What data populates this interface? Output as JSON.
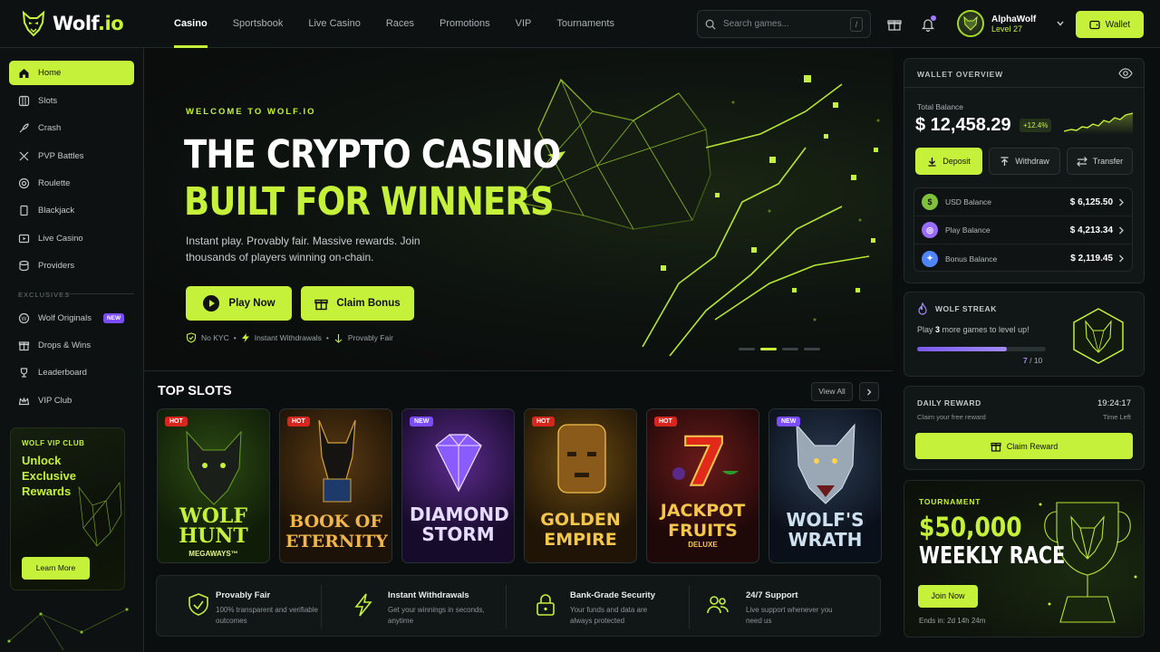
{
  "header": {
    "logo_text": "Wolf",
    "logo_tld": ".io",
    "nav": [
      "Casino",
      "Sportsbook",
      "Live Casino",
      "Races",
      "Promotions",
      "VIP",
      "Tournaments"
    ],
    "active_nav": "Casino",
    "search_placeholder": "Search games...",
    "search_shortcut": "/",
    "user": {
      "name": "AlphaWolf",
      "level": "Level 27"
    },
    "wallet_label": "Wallet"
  },
  "sidebar": {
    "items": [
      {
        "label": "Home",
        "icon": "home-icon",
        "active": true
      },
      {
        "label": "Slots",
        "icon": "slots-icon"
      },
      {
        "label": "Crash",
        "icon": "crash-icon"
      },
      {
        "label": "PVP Battles",
        "icon": "swords-icon"
      },
      {
        "label": "Roulette",
        "icon": "roulette-icon"
      },
      {
        "label": "Blackjack",
        "icon": "cards-icon"
      },
      {
        "label": "Live Casino",
        "icon": "live-icon"
      },
      {
        "label": "Providers",
        "icon": "providers-icon"
      }
    ],
    "section_label": "EXCLUSIVES",
    "exclusives": [
      {
        "label": "Wolf Originals",
        "icon": "originals-icon",
        "badge": "NEW"
      },
      {
        "label": "Drops & Wins",
        "icon": "gift-icon"
      },
      {
        "label": "Leaderboard",
        "icon": "trophy-icon"
      },
      {
        "label": "VIP Club",
        "icon": "crown-icon"
      }
    ],
    "vip_card": {
      "kicker": "WOLF VIP CLUB",
      "title": "Unlock Exclusive Rewards",
      "button": "Learn More"
    }
  },
  "hero": {
    "kicker": "WELCOME TO WOLF.IO",
    "title_line1": "THE CRYPTO CASINO",
    "title_line2": "BUILT FOR WINNERS",
    "subtitle": "Instant play. Provably fair. Massive rewards. Join thousands of players winning on-chain.",
    "play_button": "Play Now",
    "claim_button": "Claim Bonus",
    "trust": [
      "No KYC",
      "Instant Withdrawals",
      "Provably Fair"
    ],
    "slides": 4,
    "active_slide": 2
  },
  "top_slots": {
    "title": "TOP SLOTS",
    "view_all": "View All",
    "games": [
      {
        "tag": "HOT",
        "title": "WOLF HUNT",
        "subtitle": "MEGAWAYS™"
      },
      {
        "tag": "HOT",
        "title": "BOOK OF ETERNITY",
        "subtitle": ""
      },
      {
        "tag": "NEW",
        "title": "DIAMOND STORM",
        "subtitle": ""
      },
      {
        "tag": "HOT",
        "title": "GOLDEN EMPIRE",
        "subtitle": ""
      },
      {
        "tag": "HOT",
        "title": "JACKPOT FRUITS",
        "subtitle": "DELUXE"
      },
      {
        "tag": "NEW",
        "title": "WOLF'S WRATH",
        "subtitle": ""
      }
    ]
  },
  "features": [
    {
      "title": "Provably Fair",
      "desc": "100% transparent and verifiable outcomes",
      "icon": "shield-check-icon"
    },
    {
      "title": "Instant Withdrawals",
      "desc": "Get your winnings in seconds, anytime",
      "icon": "lightning-icon"
    },
    {
      "title": "Bank-Grade Security",
      "desc": "Your funds and data are always protected",
      "icon": "lock-icon"
    },
    {
      "title": "24/7 Support",
      "desc": "Live support whenever you need us",
      "icon": "users-icon"
    }
  ],
  "wallet": {
    "title": "WALLET OVERVIEW",
    "total_label": "Total Balance",
    "total_amount": "$ 12,458.29",
    "change": "+12.4%",
    "actions": [
      "Deposit",
      "Withdraw",
      "Transfer"
    ],
    "balances": [
      {
        "name": "USD Balance",
        "amount": "$ 6,125.50",
        "symbol": "$",
        "color": "#7fc23a"
      },
      {
        "name": "Play Balance",
        "amount": "$ 4,213.34",
        "symbol": "◎",
        "color": "#9a6bff"
      },
      {
        "name": "Bonus Balance",
        "amount": "$ 2,119.45",
        "symbol": "✦",
        "color": "#4f86ff"
      }
    ]
  },
  "streak": {
    "title": "WOLF STREAK",
    "text_pre": "Play ",
    "count": "3",
    "text_post": " more games to level up!",
    "progress": 0.7,
    "done": "7",
    "total": "/ 10"
  },
  "daily": {
    "title": "DAILY REWARD",
    "sub": "Claim your free reward",
    "time": "19:24:17",
    "time_label": "Time Left",
    "button": "Claim Reward"
  },
  "tournament": {
    "kicker": "TOURNAMENT",
    "amount": "$50,000",
    "name": "WEEKLY RACE",
    "button": "Join Now",
    "ends": "Ends in: 2d 14h 24m"
  }
}
